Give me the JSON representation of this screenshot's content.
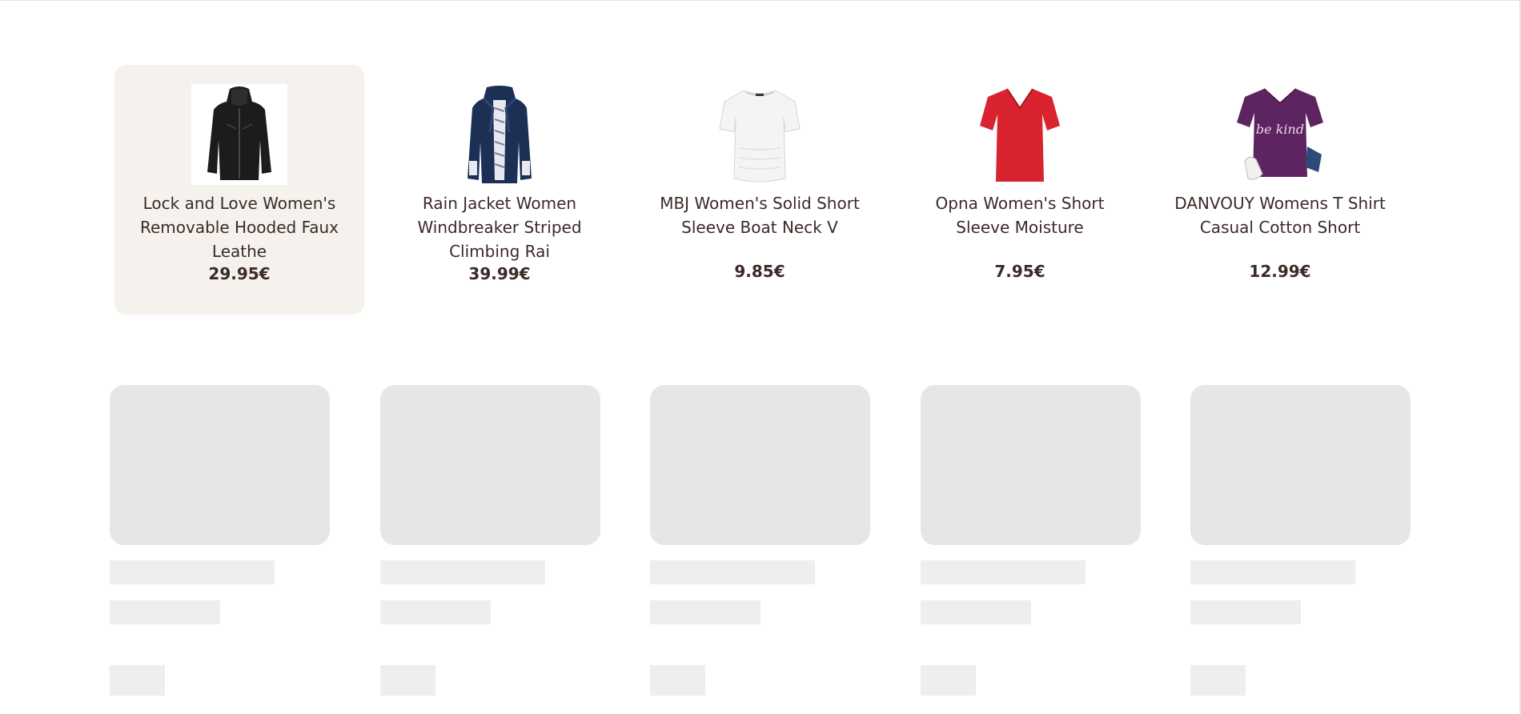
{
  "products": [
    {
      "title": "Lock and Love Women's Removable Hooded Faux Leathe",
      "price": "29.95€",
      "image_icon": "black-faux-leather-jacket",
      "color": "#1c1c1c"
    },
    {
      "title": "Rain Jacket Women Windbreaker Striped Climbing Rai",
      "price": "39.99€",
      "image_icon": "navy-rain-jacket",
      "color": "#1c2f55"
    },
    {
      "title": "MBJ Women's Solid Short Sleeve Boat Neck V",
      "price": "9.85€",
      "image_icon": "white-boat-neck-top",
      "color": "#f2f2f2"
    },
    {
      "title": "Opna Women's Short Sleeve Moisture",
      "price": "7.95€",
      "image_icon": "red-v-neck-tshirt",
      "color": "#d9232e"
    },
    {
      "title": "DANVOUY Womens T Shirt Casual Cotton Short",
      "price": "12.99€",
      "image_icon": "purple-be-kind-tshirt",
      "color": "#5e2462",
      "graphic_text": "be kind"
    }
  ],
  "theme": {
    "active_card_background": "#f5f2ee",
    "skeleton_color": "#e6e6e6",
    "skeleton_line_color": "#eeeeee",
    "text_color": "#3b2a27"
  }
}
